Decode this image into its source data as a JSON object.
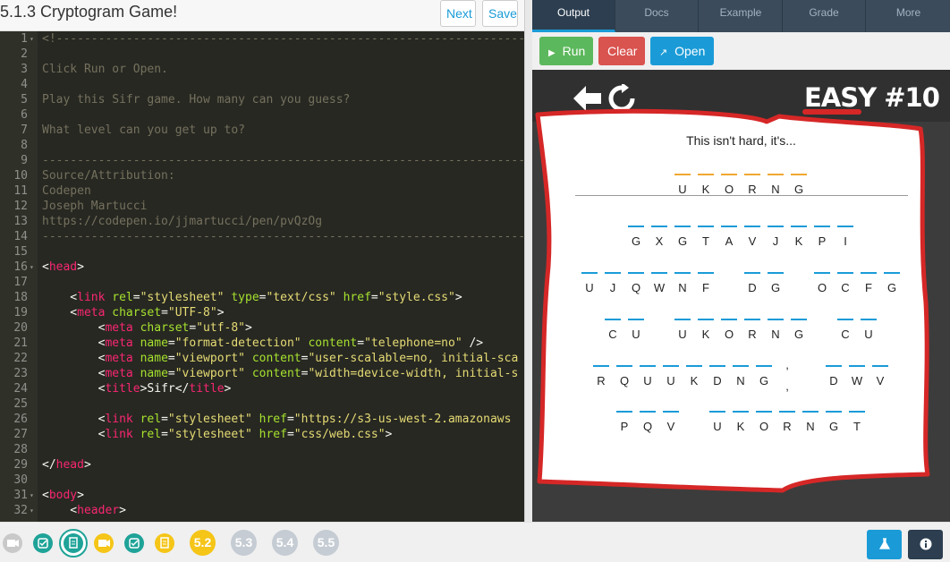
{
  "header": {
    "title": "5.1.3 Cryptogram Game!",
    "next_label": "Next",
    "save_label": "Save"
  },
  "editor": {
    "lines": [
      {
        "n": "1",
        "fold": true,
        "parts": [
          [
            "c-com",
            "<!--------------------------------------------------------------------------------"
          ]
        ]
      },
      {
        "n": "2",
        "fold": false,
        "parts": []
      },
      {
        "n": "3",
        "fold": false,
        "parts": [
          [
            "c-com",
            "Click Run or Open."
          ]
        ]
      },
      {
        "n": "4",
        "fold": false,
        "parts": []
      },
      {
        "n": "5",
        "fold": false,
        "parts": [
          [
            "c-com",
            "Play this Sifr game. How many can you guess?"
          ]
        ]
      },
      {
        "n": "6",
        "fold": false,
        "parts": []
      },
      {
        "n": "7",
        "fold": false,
        "parts": [
          [
            "c-com",
            "What level can you get up to?"
          ]
        ]
      },
      {
        "n": "8",
        "fold": false,
        "parts": []
      },
      {
        "n": "9",
        "fold": false,
        "parts": [
          [
            "c-com",
            "--------------------------------------------------------------------------------"
          ]
        ]
      },
      {
        "n": "10",
        "fold": false,
        "parts": [
          [
            "c-com",
            "Source/Attribution:"
          ]
        ]
      },
      {
        "n": "11",
        "fold": false,
        "parts": [
          [
            "c-com",
            "Codepen"
          ]
        ]
      },
      {
        "n": "12",
        "fold": false,
        "parts": [
          [
            "c-com",
            "Joseph Martucci"
          ]
        ]
      },
      {
        "n": "13",
        "fold": false,
        "parts": [
          [
            "c-com",
            "https://codepen.io/jjmartucci/pen/pvQzOg"
          ]
        ]
      },
      {
        "n": "14",
        "fold": false,
        "parts": [
          [
            "c-com",
            "---------------------------------------------------------------------------->"
          ]
        ]
      },
      {
        "n": "15",
        "fold": false,
        "parts": []
      },
      {
        "n": "16",
        "fold": true,
        "parts": [
          [
            "c-txt",
            "<"
          ],
          [
            "c-tag",
            "head"
          ],
          [
            "c-txt",
            ">"
          ]
        ]
      },
      {
        "n": "17",
        "fold": false,
        "parts": []
      },
      {
        "n": "18",
        "fold": false,
        "parts": [
          [
            "c-txt",
            "    <"
          ],
          [
            "c-tag",
            "link"
          ],
          [
            "c-txt",
            " "
          ],
          [
            "c-attr",
            "rel"
          ],
          [
            "c-txt",
            "="
          ],
          [
            "c-str",
            "\"stylesheet\""
          ],
          [
            "c-txt",
            " "
          ],
          [
            "c-attr",
            "type"
          ],
          [
            "c-txt",
            "="
          ],
          [
            "c-str",
            "\"text/css\""
          ],
          [
            "c-txt",
            " "
          ],
          [
            "c-attr",
            "href"
          ],
          [
            "c-txt",
            "="
          ],
          [
            "c-str",
            "\"style.css\""
          ],
          [
            "c-txt",
            ">"
          ]
        ]
      },
      {
        "n": "19",
        "fold": false,
        "parts": [
          [
            "c-txt",
            "    <"
          ],
          [
            "c-tag",
            "meta"
          ],
          [
            "c-txt",
            " "
          ],
          [
            "c-attr",
            "charset"
          ],
          [
            "c-txt",
            "="
          ],
          [
            "c-str",
            "\"UTF-8\""
          ],
          [
            "c-txt",
            ">"
          ]
        ]
      },
      {
        "n": "20",
        "fold": false,
        "parts": [
          [
            "c-txt",
            "        <"
          ],
          [
            "c-tag",
            "meta"
          ],
          [
            "c-txt",
            " "
          ],
          [
            "c-attr",
            "charset"
          ],
          [
            "c-txt",
            "="
          ],
          [
            "c-str",
            "\"utf-8\""
          ],
          [
            "c-txt",
            ">"
          ]
        ]
      },
      {
        "n": "21",
        "fold": false,
        "parts": [
          [
            "c-txt",
            "        <"
          ],
          [
            "c-tag",
            "meta"
          ],
          [
            "c-txt",
            " "
          ],
          [
            "c-attr",
            "name"
          ],
          [
            "c-txt",
            "="
          ],
          [
            "c-str",
            "\"format-detection\""
          ],
          [
            "c-txt",
            " "
          ],
          [
            "c-attr",
            "content"
          ],
          [
            "c-txt",
            "="
          ],
          [
            "c-str",
            "\"telephone=no\""
          ],
          [
            "c-txt",
            " />"
          ]
        ]
      },
      {
        "n": "22",
        "fold": false,
        "parts": [
          [
            "c-txt",
            "        <"
          ],
          [
            "c-tag",
            "meta"
          ],
          [
            "c-txt",
            " "
          ],
          [
            "c-attr",
            "name"
          ],
          [
            "c-txt",
            "="
          ],
          [
            "c-str",
            "\"viewport\""
          ],
          [
            "c-txt",
            " "
          ],
          [
            "c-attr",
            "content"
          ],
          [
            "c-txt",
            "="
          ],
          [
            "c-str",
            "\"user-scalable=no, initial-sca"
          ]
        ]
      },
      {
        "n": "23",
        "fold": false,
        "parts": [
          [
            "c-txt",
            "        <"
          ],
          [
            "c-tag",
            "meta"
          ],
          [
            "c-txt",
            " "
          ],
          [
            "c-attr",
            "name"
          ],
          [
            "c-txt",
            "="
          ],
          [
            "c-str",
            "\"viewport\""
          ],
          [
            "c-txt",
            " "
          ],
          [
            "c-attr",
            "content"
          ],
          [
            "c-txt",
            "="
          ],
          [
            "c-str",
            "\"width=device-width, initial-s"
          ]
        ]
      },
      {
        "n": "24",
        "fold": false,
        "parts": [
          [
            "c-txt",
            "        <"
          ],
          [
            "c-tag",
            "title"
          ],
          [
            "c-txt",
            ">Sifr</"
          ],
          [
            "c-tag",
            "title"
          ],
          [
            "c-txt",
            ">"
          ]
        ]
      },
      {
        "n": "25",
        "fold": false,
        "parts": []
      },
      {
        "n": "26",
        "fold": false,
        "parts": [
          [
            "c-txt",
            "        <"
          ],
          [
            "c-tag",
            "link"
          ],
          [
            "c-txt",
            " "
          ],
          [
            "c-attr",
            "rel"
          ],
          [
            "c-txt",
            "="
          ],
          [
            "c-str",
            "\"stylesheet\""
          ],
          [
            "c-txt",
            " "
          ],
          [
            "c-attr",
            "href"
          ],
          [
            "c-txt",
            "="
          ],
          [
            "c-str",
            "\"https://s3-us-west-2.amazonaws"
          ]
        ]
      },
      {
        "n": "27",
        "fold": false,
        "parts": [
          [
            "c-txt",
            "        <"
          ],
          [
            "c-tag",
            "link"
          ],
          [
            "c-txt",
            " "
          ],
          [
            "c-attr",
            "rel"
          ],
          [
            "c-txt",
            "="
          ],
          [
            "c-str",
            "\"stylesheet\""
          ],
          [
            "c-txt",
            " "
          ],
          [
            "c-attr",
            "href"
          ],
          [
            "c-txt",
            "="
          ],
          [
            "c-str",
            "\"css/web.css\""
          ],
          [
            "c-txt",
            ">"
          ]
        ]
      },
      {
        "n": "28",
        "fold": false,
        "parts": []
      },
      {
        "n": "29",
        "fold": false,
        "parts": [
          [
            "c-txt",
            "</"
          ],
          [
            "c-tag",
            "head"
          ],
          [
            "c-txt",
            ">"
          ]
        ]
      },
      {
        "n": "30",
        "fold": false,
        "parts": []
      },
      {
        "n": "31",
        "fold": true,
        "parts": [
          [
            "c-txt",
            "<"
          ],
          [
            "c-tag",
            "body"
          ],
          [
            "c-txt",
            ">"
          ]
        ]
      },
      {
        "n": "32",
        "fold": true,
        "parts": [
          [
            "c-txt",
            "    <"
          ],
          [
            "c-tag",
            "header"
          ],
          [
            "c-txt",
            ">"
          ]
        ]
      }
    ]
  },
  "output_tabs": [
    "Output",
    "Docs",
    "Example",
    "Grade",
    "More"
  ],
  "run_bar": {
    "run_label": "Run",
    "clear_label": "Clear",
    "open_label": "Open"
  },
  "game": {
    "level_title": "EASY #10",
    "hint": "This isn't hard, it's...",
    "answer_rows": [
      {
        "words": [
          [
            "U",
            "K",
            "O",
            "R",
            "N",
            "G"
          ]
        ]
      }
    ],
    "puzzle_rows": [
      {
        "words": [
          [
            "G",
            "X",
            "G",
            "T",
            "A",
            "V",
            "J",
            "K",
            "P",
            "I"
          ]
        ]
      },
      {
        "words": [
          [
            "U",
            "J",
            "Q",
            "W",
            "N",
            "F"
          ],
          [
            "D",
            "G"
          ],
          [
            "O",
            "C",
            "F",
            "G"
          ]
        ]
      },
      {
        "words": [
          [
            "C",
            "U"
          ],
          [
            "U",
            "K",
            "O",
            "R",
            "N",
            "G"
          ],
          [
            "C",
            "U"
          ]
        ]
      },
      {
        "words": [
          [
            "R",
            "Q",
            "U",
            "U",
            "K",
            "D",
            "N",
            "G",
            ","
          ],
          [
            "D",
            "W",
            "V"
          ]
        ]
      },
      {
        "words": [
          [
            "P",
            "Q",
            "V"
          ],
          [
            "U",
            "K",
            "O",
            "R",
            "N",
            "G",
            "T"
          ]
        ]
      }
    ],
    "colors": {
      "bar": "#1a9bd7",
      "answer_bar": "#f0a830",
      "paper_outline": "#d62727"
    }
  },
  "bottom": {
    "lessons": [
      "5.2",
      "5.3",
      "5.4",
      "5.5"
    ],
    "progress_icons": [
      "video-icon",
      "check-icon",
      "document-icon",
      "video-icon",
      "check-icon",
      "document-icon"
    ]
  }
}
